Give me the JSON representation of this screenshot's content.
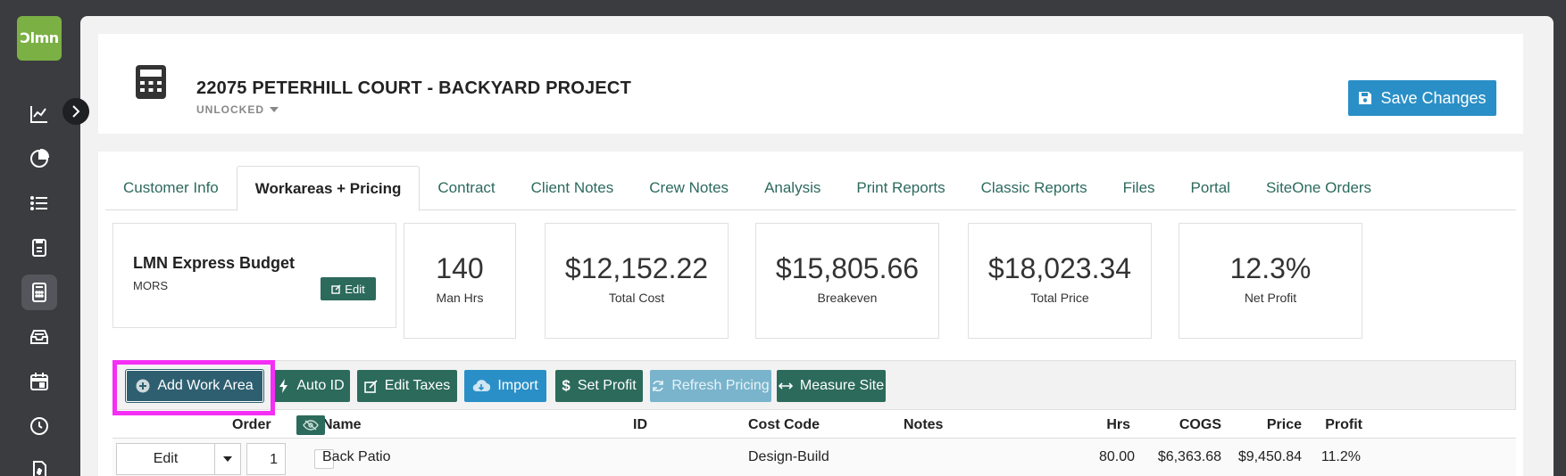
{
  "app": {
    "logo_text": "Ɔlmn"
  },
  "sidebar": {
    "items": [
      {
        "icon": "line-chart-icon"
      },
      {
        "icon": "pie-chart-icon"
      },
      {
        "icon": "list-icon"
      },
      {
        "icon": "clipboard-icon"
      },
      {
        "icon": "calculator-icon",
        "active": true
      },
      {
        "icon": "inbox-icon"
      },
      {
        "icon": "calendar-icon"
      },
      {
        "icon": "clock-icon"
      },
      {
        "icon": "invoice-icon"
      }
    ]
  },
  "header": {
    "title": "22075 PETERHILL COURT - BACKYARD PROJECT",
    "status": "UNLOCKED",
    "save_label": "Save Changes"
  },
  "tabs": [
    {
      "label": "Customer Info"
    },
    {
      "label": "Workareas + Pricing",
      "active": true
    },
    {
      "label": "Contract"
    },
    {
      "label": "Client Notes"
    },
    {
      "label": "Crew Notes"
    },
    {
      "label": "Analysis"
    },
    {
      "label": "Print Reports"
    },
    {
      "label": "Classic Reports"
    },
    {
      "label": "Files"
    },
    {
      "label": "Portal"
    },
    {
      "label": "SiteOne Orders"
    }
  ],
  "budget": {
    "title": "LMN Express Budget",
    "subtitle": "MORS",
    "edit_label": "Edit"
  },
  "stats": [
    {
      "value": "140",
      "label": "Man Hrs"
    },
    {
      "value": "$12,152.22",
      "label": "Total Cost"
    },
    {
      "value": "$15,805.66",
      "label": "Breakeven"
    },
    {
      "value": "$18,023.34",
      "label": "Total Price"
    },
    {
      "value": "12.3%",
      "label": "Net Profit"
    }
  ],
  "toolbar": {
    "add_work_area": "Add Work Area",
    "auto_id": "Auto ID",
    "edit_taxes": "Edit Taxes",
    "import": "Import",
    "set_profit": "Set Profit",
    "refresh_pricing": "Refresh Pricing",
    "measure_site": "Measure Site"
  },
  "table": {
    "columns": {
      "order": "Order",
      "name": "Name",
      "id": "ID",
      "cost_code": "Cost Code",
      "notes": "Notes",
      "hrs": "Hrs",
      "cogs": "COGS",
      "price": "Price",
      "profit": "Profit"
    },
    "rows": [
      {
        "edit_label": "Edit",
        "order": "1",
        "name": "Back Patio",
        "id": "",
        "cost_code": "Design-Build",
        "notes": "",
        "hrs": "80.00",
        "cogs": "$6,363.68",
        "price": "$9,450.84",
        "profit": "11.2%"
      }
    ]
  }
}
